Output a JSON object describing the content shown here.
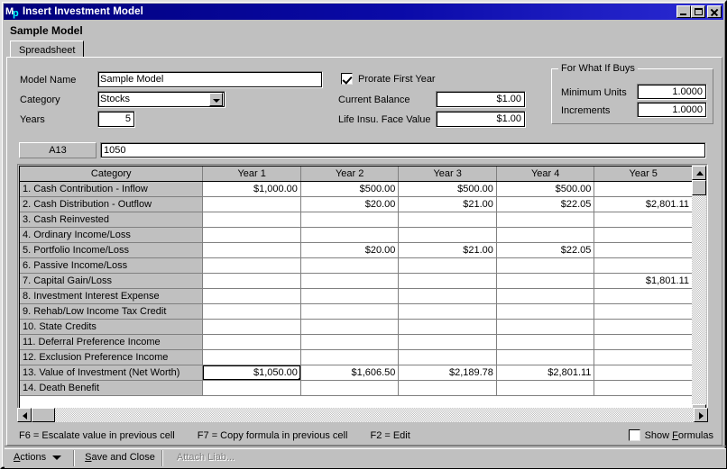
{
  "window": {
    "title": "Insert Investment Model",
    "icon": "mp-app-icon",
    "controls": {
      "minimize": "minimize-icon",
      "maximize": "maximize-icon",
      "close": "close-icon"
    }
  },
  "doc_title": "Sample Model",
  "tabs": [
    {
      "label": "Spreadsheet",
      "active": true
    }
  ],
  "form": {
    "model_name": {
      "label": "Model Name",
      "value": "Sample Model"
    },
    "category": {
      "label": "Category",
      "value": "Stocks"
    },
    "years": {
      "label": "Years",
      "value": "5"
    },
    "prorate_first_year": {
      "label": "Prorate First Year",
      "checked": true
    },
    "current_balance": {
      "label": "Current Balance",
      "value": "$1.00"
    },
    "life_insu_face_value": {
      "label": "Life Insu. Face Value",
      "value": "$1.00"
    }
  },
  "what_if_buys": {
    "title": "For What If Buys",
    "minimum_units": {
      "label": "Minimum Units",
      "value": "1.0000"
    },
    "increments": {
      "label": "Increments",
      "value": "1.0000"
    }
  },
  "formula_bar": {
    "cell_ref": "A13",
    "content": "1050"
  },
  "grid": {
    "columns": [
      "Category",
      "Year 1",
      "Year 2",
      "Year 3",
      "Year 4",
      "Year 5"
    ],
    "selected_cell": {
      "row": 12,
      "col": 1
    },
    "rows": [
      {
        "category": "1. Cash Contribution - Inflow",
        "values": [
          "$1,000.00",
          "$500.00",
          "$500.00",
          "$500.00",
          ""
        ]
      },
      {
        "category": "2. Cash Distribution - Outflow",
        "values": [
          "",
          "$20.00",
          "$21.00",
          "$22.05",
          "$2,801.11"
        ]
      },
      {
        "category": "3. Cash Reinvested",
        "values": [
          "",
          "",
          "",
          "",
          ""
        ]
      },
      {
        "category": "4. Ordinary Income/Loss",
        "values": [
          "",
          "",
          "",
          "",
          ""
        ]
      },
      {
        "category": "5. Portfolio Income/Loss",
        "values": [
          "",
          "$20.00",
          "$21.00",
          "$22.05",
          ""
        ]
      },
      {
        "category": "6. Passive Income/Loss",
        "values": [
          "",
          "",
          "",
          "",
          ""
        ]
      },
      {
        "category": "7. Capital Gain/Loss",
        "values": [
          "",
          "",
          "",
          "",
          "$1,801.11"
        ]
      },
      {
        "category": "8. Investment Interest Expense",
        "values": [
          "",
          "",
          "",
          "",
          ""
        ]
      },
      {
        "category": "9. Rehab/Low Income Tax Credit",
        "values": [
          "",
          "",
          "",
          "",
          ""
        ]
      },
      {
        "category": "10. State Credits",
        "values": [
          "",
          "",
          "",
          "",
          ""
        ]
      },
      {
        "category": "11. Deferral Preference Income",
        "values": [
          "",
          "",
          "",
          "",
          ""
        ]
      },
      {
        "category": "12. Exclusion Preference Income",
        "values": [
          "",
          "",
          "",
          "",
          ""
        ]
      },
      {
        "category": "13. Value of Investment (Net Worth)",
        "values": [
          "$1,050.00",
          "$1,606.50",
          "$2,189.78",
          "$2,801.11",
          ""
        ]
      },
      {
        "category": "14. Death Benefit",
        "values": [
          "",
          "",
          "",
          "",
          ""
        ]
      }
    ]
  },
  "hints": [
    "F6 = Escalate value in previous cell",
    "F7 = Copy formula in previous cell",
    "F2 = Edit"
  ],
  "show_formulas": {
    "label_pre": "Show ",
    "label_accel": "F",
    "label_post": "ormulas",
    "checked": false
  },
  "bottom_bar": {
    "actions": {
      "label_accel": "A",
      "label_post": "ctions"
    },
    "save_and_close": {
      "label_accel": "S",
      "label_post": "ave and Close"
    },
    "attach_liab": {
      "label": "Attach Liab...",
      "enabled": false
    }
  }
}
